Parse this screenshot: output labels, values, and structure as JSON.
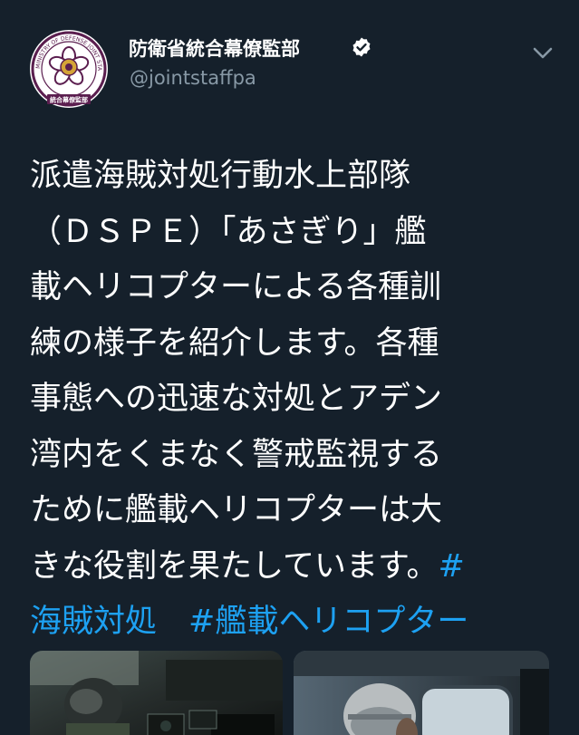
{
  "author": {
    "name": "防衛省統合幕僚監部",
    "handle": "@jointstaffpa",
    "verified": true,
    "avatar_icon": "ministry-of-defense-emblem",
    "avatar_text": {
      "top_ring": "MINISTRY OF DEFENSE JOINT STAFF JAPAN",
      "bottom_band": "統合幕僚監部"
    }
  },
  "tweet": {
    "lines": [
      [
        {
          "text": "派遣海賊対処行動水上部隊",
          "hashtag": false
        }
      ],
      [
        {
          "text": "（ＤＳＰＥ）「あさぎり」艦",
          "hashtag": false
        }
      ],
      [
        {
          "text": "載ヘリコプターによる各種訓",
          "hashtag": false
        }
      ],
      [
        {
          "text": "練の様子を紹介します。各種",
          "hashtag": false
        }
      ],
      [
        {
          "text": "事態への迅速な対処とアデン",
          "hashtag": false
        }
      ],
      [
        {
          "text": "湾内をくまなく警戒監視する",
          "hashtag": false
        }
      ],
      [
        {
          "text": "ために艦載ヘリコプターは大",
          "hashtag": false
        }
      ],
      [
        {
          "text": "きな役割を果たしています。",
          "hashtag": false
        },
        {
          "text": "#",
          "hashtag": true
        }
      ],
      [
        {
          "text": "海賊対処",
          "hashtag": true
        },
        {
          "text": "　",
          "hashtag": false
        },
        {
          "text": "#艦載ヘリコプター",
          "hashtag": true
        }
      ]
    ]
  },
  "media": [
    {
      "icon": "photo-helicopter-cockpit-pilot"
    },
    {
      "icon": "photo-helicopter-cabin-crew-helmet"
    }
  ],
  "icons": {
    "verified": "verified-badge-icon",
    "more": "chevron-down-icon"
  },
  "colors": {
    "background": "#15202b",
    "text": "#ffffff",
    "secondary": "#8899a6",
    "hashtag": "#1da1f2",
    "avatar_ring": "#5b1e4f"
  }
}
